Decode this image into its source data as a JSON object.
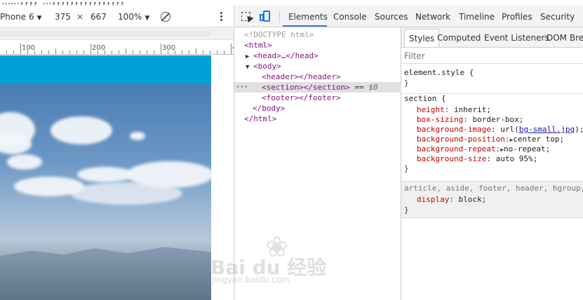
{
  "top_cut_text": "……，，，，…，，，，，，，，，，，，，，，，",
  "device_toolbar": {
    "device_name": "Phone 6",
    "width": "375",
    "times": "×",
    "height": "667",
    "zoom": "100%"
  },
  "ruler": {
    "labels": [
      "100",
      "200",
      "300",
      "4"
    ]
  },
  "devtools_tabs": [
    "Elements",
    "Console",
    "Sources",
    "Network",
    "Timeline",
    "Profiles",
    "Security"
  ],
  "elements_tree": {
    "doctype": "<!DOCTYPE html>",
    "html_open": "<html>",
    "head": "<head>…</head>",
    "body_open": "<body>",
    "header": "<header></header>",
    "section": "<section></section>",
    "section_eq": "==",
    "section_ref": "$0",
    "footer": "<footer></footer>",
    "body_close": "</body>",
    "html_close": "</html>",
    "dots": "•••"
  },
  "styles_tabs": [
    "Styles",
    "Computed",
    "Event Listeners",
    "DOM Brea"
  ],
  "filter_placeholder": "Filter",
  "rules": {
    "element_style": "element.style {",
    "element_close": "}",
    "section_selector": "section {",
    "props": [
      {
        "name": "height",
        "value": "inherit;"
      },
      {
        "name": "box-sizing",
        "value": "border-box;"
      },
      {
        "name": "background-image",
        "value_prefix": "url(",
        "link": "bg-small.jpg",
        "value_suffix": ");"
      },
      {
        "name": "background-position",
        "value": "center top;"
      },
      {
        "name": "background-repeat",
        "value": "no-repeat;"
      },
      {
        "name": "background-size",
        "value": "auto 95%;"
      }
    ],
    "section_close": "}",
    "ua_selector": "article, aside, footer, header, hgroup, n",
    "ua_prop": {
      "name": "display",
      "value": "block;"
    },
    "ua_close": "}"
  },
  "watermark": {
    "text": "Bai du 经验",
    "sub": "jingyan.baidu.com"
  },
  "colors": {
    "accent": "#00a1d6",
    "tab_underline": "#3879d9",
    "tag": "#881280",
    "prop": "#c80000"
  }
}
